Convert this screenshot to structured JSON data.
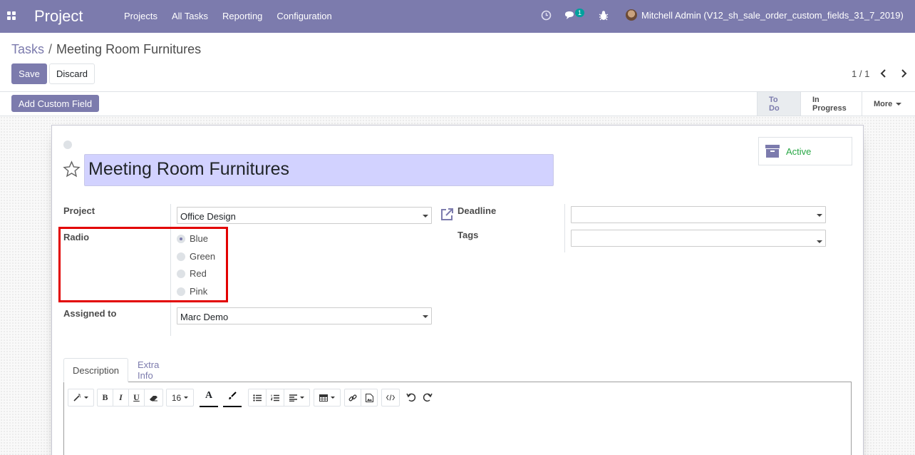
{
  "navbar": {
    "app_title": "Project",
    "menu": [
      "Projects",
      "All Tasks",
      "Reporting",
      "Configuration"
    ],
    "chat_badge": "1",
    "user": "Mitchell Admin (V12_sh_sale_order_custom_fields_31_7_2019)",
    "icons": [
      "apps-grid-icon",
      "clock-icon",
      "chat-icon",
      "bug-icon"
    ]
  },
  "breadcrumb": {
    "parent": "Tasks",
    "separator": "/",
    "current": "Meeting Room Furnitures"
  },
  "buttons": {
    "save": "Save",
    "discard": "Discard",
    "add_custom_field": "Add Custom Field"
  },
  "pager": {
    "value": "1 / 1"
  },
  "stages": [
    {
      "label": "To Do",
      "active": true
    },
    {
      "label": "In Progress",
      "active": false
    },
    {
      "label": "More",
      "active": false
    }
  ],
  "form": {
    "title": "Meeting Room Furnitures",
    "active_label": "Active",
    "project": {
      "label": "Project",
      "value": "Office Design"
    },
    "radio": {
      "label": "Radio",
      "options": [
        "Blue",
        "Green",
        "Red",
        "Pink"
      ],
      "selected": "Blue"
    },
    "assigned_to": {
      "label": "Assigned to",
      "value": "Marc Demo"
    },
    "deadline": {
      "label": "Deadline",
      "value": ""
    },
    "tags": {
      "label": "Tags",
      "value": ""
    }
  },
  "notebook": {
    "tabs": [
      "Description",
      "Extra Info"
    ],
    "active_tab": "Description"
  },
  "editor_toolbar": {
    "font_size": "16",
    "bold": "B",
    "italic": "I",
    "underline": "U",
    "color_letter": "A"
  },
  "colors": {
    "primary": "#7c7bad",
    "title_bg": "#d2d2ff",
    "active_green": "#28a745",
    "highlight_red": "#e20000"
  }
}
